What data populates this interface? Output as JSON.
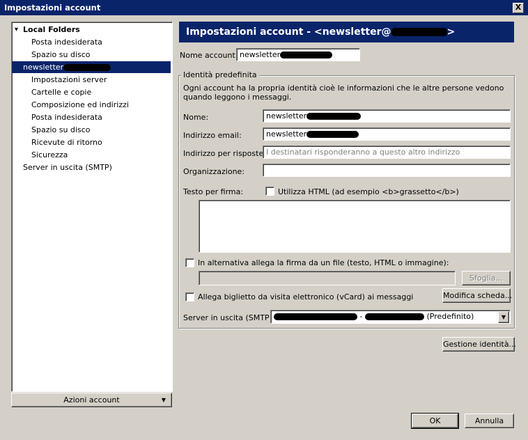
{
  "window": {
    "title": "Impostazioni account",
    "close_glyph": "X"
  },
  "tree": {
    "items": [
      {
        "label": "Local Folders",
        "indent": 0,
        "bold": true,
        "expander": true
      },
      {
        "label": "Posta indesiderata",
        "indent": 1
      },
      {
        "label": "Spazio su disco",
        "indent": 1
      },
      {
        "label": "newsletter",
        "indent": 0,
        "selected": true,
        "redacted": true
      },
      {
        "label": "Impostazioni server",
        "indent": 1
      },
      {
        "label": "Cartelle e copie",
        "indent": 1
      },
      {
        "label": "Composizione ed indirizzi",
        "indent": 1
      },
      {
        "label": "Posta indesiderata",
        "indent": 1
      },
      {
        "label": "Spazio su disco",
        "indent": 1
      },
      {
        "label": "Ricevute di ritorno",
        "indent": 1
      },
      {
        "label": "Sicurezza",
        "indent": 1
      },
      {
        "label": "Server in uscita (SMTP)",
        "indent": 0
      }
    ],
    "actions_button": "Azioni account"
  },
  "header": {
    "title_prefix": "Impostazioni account - <newsletter@",
    "title_suffix": ">"
  },
  "account": {
    "name_label": "Nome account:",
    "name_value": "newsletter"
  },
  "identity": {
    "legend": "Identità predefinita",
    "description": "Ogni account ha la propria identità cioè le informazioni che le altre persone vedono quando leggono i messaggi.",
    "name_label": "Nome:",
    "name_value": "newsletter",
    "email_label": "Indirizzo email:",
    "email_value": "newsletter",
    "reply_label": "Indirizzo per risposte:",
    "reply_placeholder": "I destinatari risponderanno a questo altro indirizzo",
    "org_label": "Organizzazione:",
    "org_value": "",
    "signature_label": "Testo per firma:",
    "html_checkbox": "Utilizza HTML (ad esempio <b>grassetto</b>)",
    "file_checkbox": "In alternativa allega la firma da un file (testo, HTML o immagine):",
    "browse_button": "Sfoglia...",
    "vcard_checkbox": "Allega biglietto da visita elettronico (vCard) ai messaggi",
    "edit_card_button": "Modifica scheda...",
    "smtp_label": "Server in uscita (SMTP):",
    "smtp_value_separator": " - ",
    "smtp_value_suffix": " (Predefinito)"
  },
  "buttons": {
    "manage_identities": "Gestione identità...",
    "ok": "OK",
    "cancel": "Annulla"
  }
}
